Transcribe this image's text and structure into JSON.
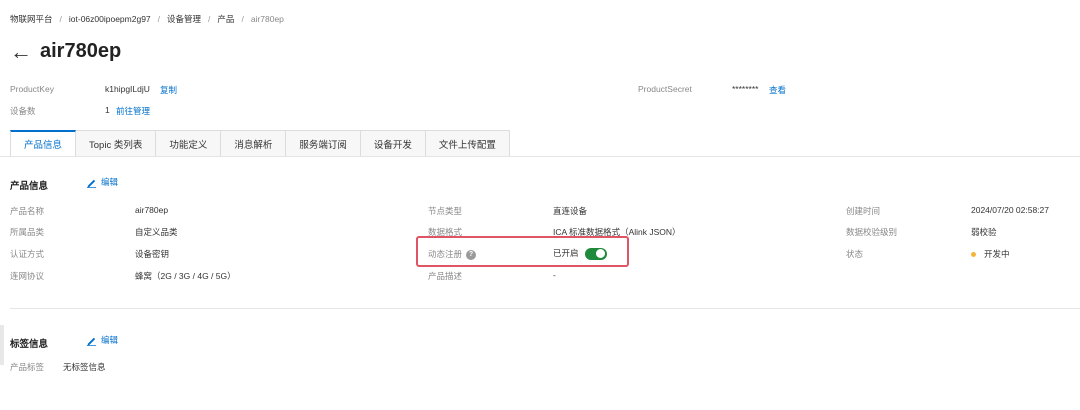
{
  "breadcrumb": {
    "items": [
      "物联网平台",
      "iot-06z00ipoepm2g97",
      "设备管理",
      "产品",
      "air780ep"
    ],
    "separator": "/"
  },
  "header": {
    "title": "air780ep"
  },
  "summary": {
    "product_key_label": "ProductKey",
    "product_key_value": "k1hipgILdjU",
    "copy_label": "复制",
    "device_count_label": "设备数",
    "device_count_value": "1",
    "manage_link": "前往管理",
    "product_secret_label": "ProductSecret",
    "product_secret_value": "********",
    "view_link": "查看"
  },
  "tabs": [
    {
      "label": "产品信息",
      "active": true
    },
    {
      "label": "Topic 类列表",
      "active": false
    },
    {
      "label": "功能定义",
      "active": false
    },
    {
      "label": "消息解析",
      "active": false
    },
    {
      "label": "服务端订阅",
      "active": false
    },
    {
      "label": "设备开发",
      "active": false
    },
    {
      "label": "文件上传配置",
      "active": false
    }
  ],
  "product_info": {
    "title": "产品信息",
    "edit_label": "编辑",
    "name_label": "产品名称",
    "name_value": "air780ep",
    "category_label": "所属品类",
    "category_value": "自定义品类",
    "auth_label": "认证方式",
    "auth_value": "设备密钥",
    "network_label": "连网协议",
    "network_value": "蜂窝（2G / 3G / 4G / 5G）",
    "node_type_label": "节点类型",
    "node_type_value": "直连设备",
    "data_format_label": "数据格式",
    "data_format_value": "ICA 标准数据格式（Alink JSON）",
    "dynamic_reg_label": "动态注册",
    "dynamic_reg_value": "已开启",
    "description_label": "产品描述",
    "description_value": "-",
    "created_label": "创建时间",
    "created_value": "2024/07/20 02:58:27",
    "check_level_label": "数据校验级别",
    "check_level_value": "弱校验",
    "status_label": "状态",
    "status_value": "开发中"
  },
  "tag_info": {
    "title": "标签信息",
    "edit_label": "编辑",
    "tag_label": "产品标签",
    "tag_value": "无标签信息"
  },
  "colors": {
    "accent": "#0070cc",
    "toggle_on": "#1f8a3c",
    "highlight": "#e05563",
    "status_dev": "#f5b53d"
  }
}
